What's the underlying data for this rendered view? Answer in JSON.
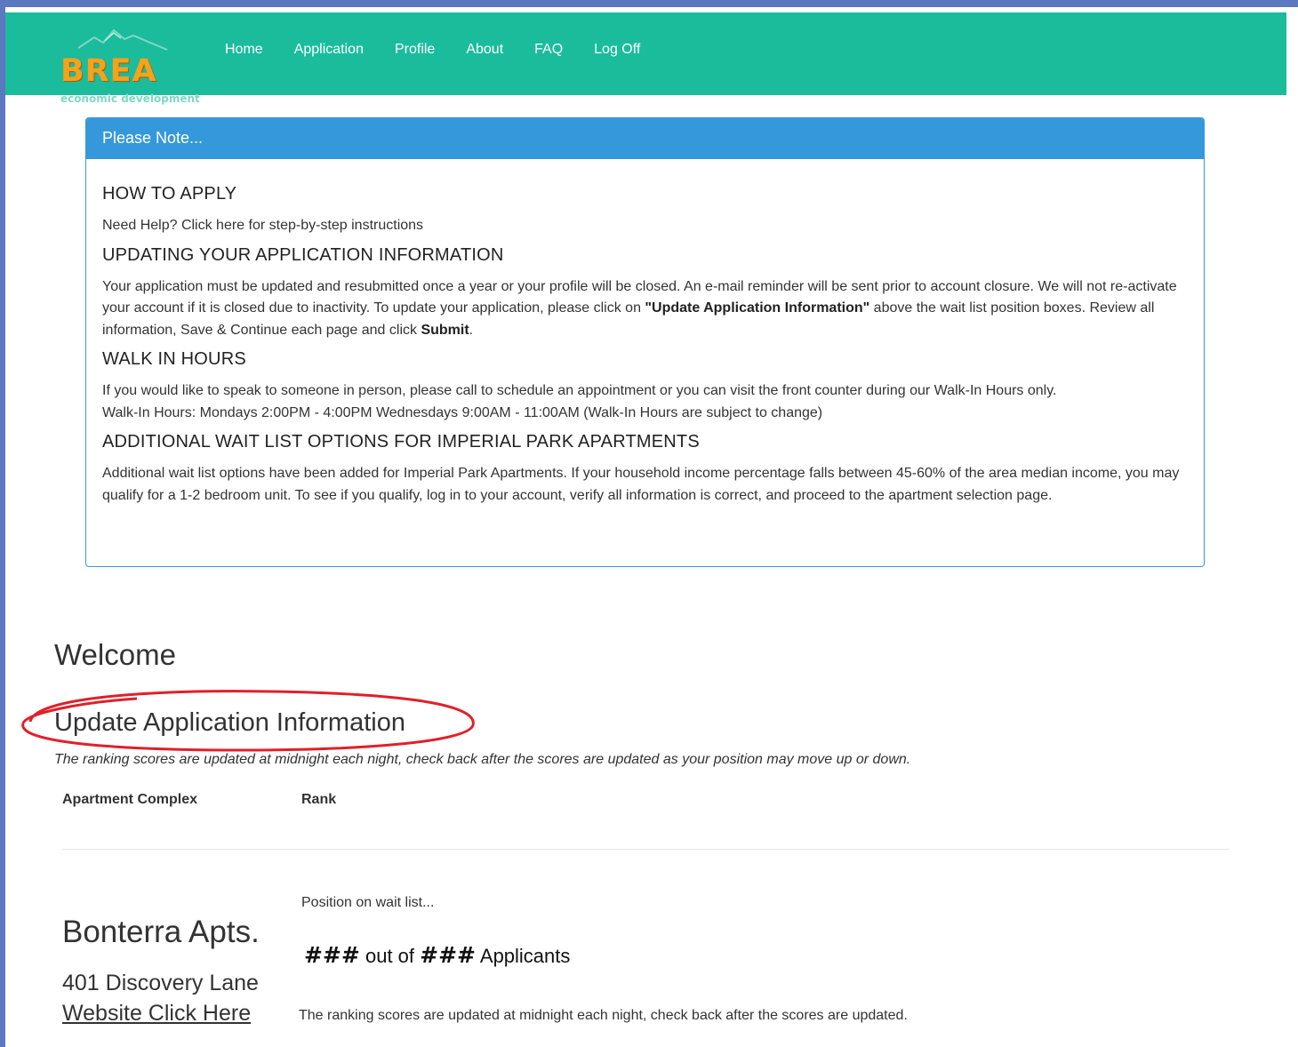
{
  "brand": {
    "logo_text": "BREA",
    "logo_subtext": "economic development",
    "color": "#f5a21c"
  },
  "nav": {
    "items": [
      {
        "label": "Home"
      },
      {
        "label": "Application"
      },
      {
        "label": "Profile"
      },
      {
        "label": "About"
      },
      {
        "label": "FAQ"
      },
      {
        "label": "Log Off"
      }
    ],
    "bg_color": "#1abc9c"
  },
  "notice": {
    "heading": "Please Note...",
    "sections": [
      {
        "title": "HOW TO APPLY",
        "text": "Need Help? Click here for step-by-step instructions"
      },
      {
        "title": "UPDATING YOUR APPLICATION INFORMATION",
        "text_1": "Your application must be updated and resubmitted once a year or your profile will be closed. An e-mail reminder will be sent prior to account closure. We will not re-activate your account if it is closed due to inactivity. To update your application, please click on ",
        "bold_1": "\"Update Application Information\"",
        "text_2": " above the wait list position boxes. Review all information, Save & Continue each page and click ",
        "bold_2": "Submit",
        "text_3": "."
      },
      {
        "title": "WALK IN HOURS",
        "text": "If you would like to speak to someone in person, please call to schedule an appointment or you can visit the front counter during our Walk-In Hours only.",
        "text_2": "Walk-In Hours: Mondays 2:00PM - 4:00PM Wednesdays 9:00AM - 11:00AM (Walk-In Hours are subject to change)"
      },
      {
        "title": "ADDITIONAL WAIT LIST OPTIONS FOR IMPERIAL PARK APARTMENTS",
        "text": "Additional wait list options have been added for Imperial Park Apartments. If your household income percentage falls between 45-60% of the area median income, you may qualify for a 1-2 bedroom unit. To see if you qualify, log in to your account, verify all information is correct, and proceed to the apartment selection page."
      }
    ],
    "color": "#3498db"
  },
  "main": {
    "welcome": "Welcome",
    "update_link": "Update Application Information",
    "highlight_color": "#e0202a",
    "ranking_note": "The ranking scores are updated at midnight each night, check back after the scores are updated as your position may move up or down.",
    "table_headers": {
      "complex": "Apartment Complex",
      "rank": "Rank"
    },
    "apartments": [
      {
        "name": "Bonterra Apts.",
        "address": "401 Discovery Lane",
        "website_label": "Website Click Here",
        "position_label": "Position on wait list...",
        "position": "###",
        "out_of_text": "out of",
        "total": "###",
        "applicants_text": "Applicants",
        "note": "The ranking scores are updated at midnight each night, check back after the scores are updated."
      }
    ]
  }
}
